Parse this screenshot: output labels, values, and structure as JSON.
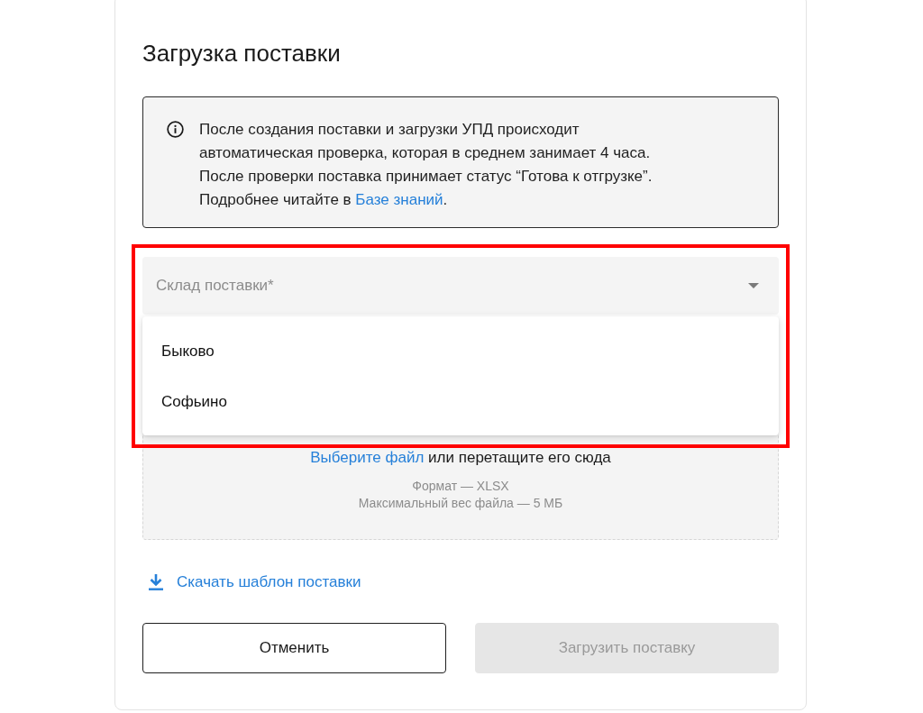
{
  "title": "Загрузка поставки",
  "notice": {
    "lines": [
      "После создания поставки и загрузки УПД происходит",
      "автоматическая проверка, которая в среднем занимает 4 часа.",
      "После проверки поставка принимает статус “Готова к отгрузке”.",
      "Подробнее читайте в"
    ],
    "link": "Базе знаний",
    "after_link": "."
  },
  "warehouse_select": {
    "placeholder": "Склад поставки*",
    "expanded": true,
    "options": [
      {
        "label": "Быково",
        "selected": false
      },
      {
        "label": "Софьино",
        "selected": false
      }
    ]
  },
  "dropzone": {
    "link": "Выберите файл",
    "text": "или перетащите его сюда",
    "hints": [
      "Формат — XLSX",
      "Максимальный вес файла — 5 МБ"
    ]
  },
  "download_link": {
    "label": "Скачать шаблон поставки"
  },
  "buttons": [
    {
      "label": "Отменить",
      "kind": "secondary",
      "disabled": false
    },
    {
      "label": "Загрузить поставку",
      "kind": "primary",
      "disabled": true
    }
  ],
  "annotation": {
    "kind": "outline"
  }
}
